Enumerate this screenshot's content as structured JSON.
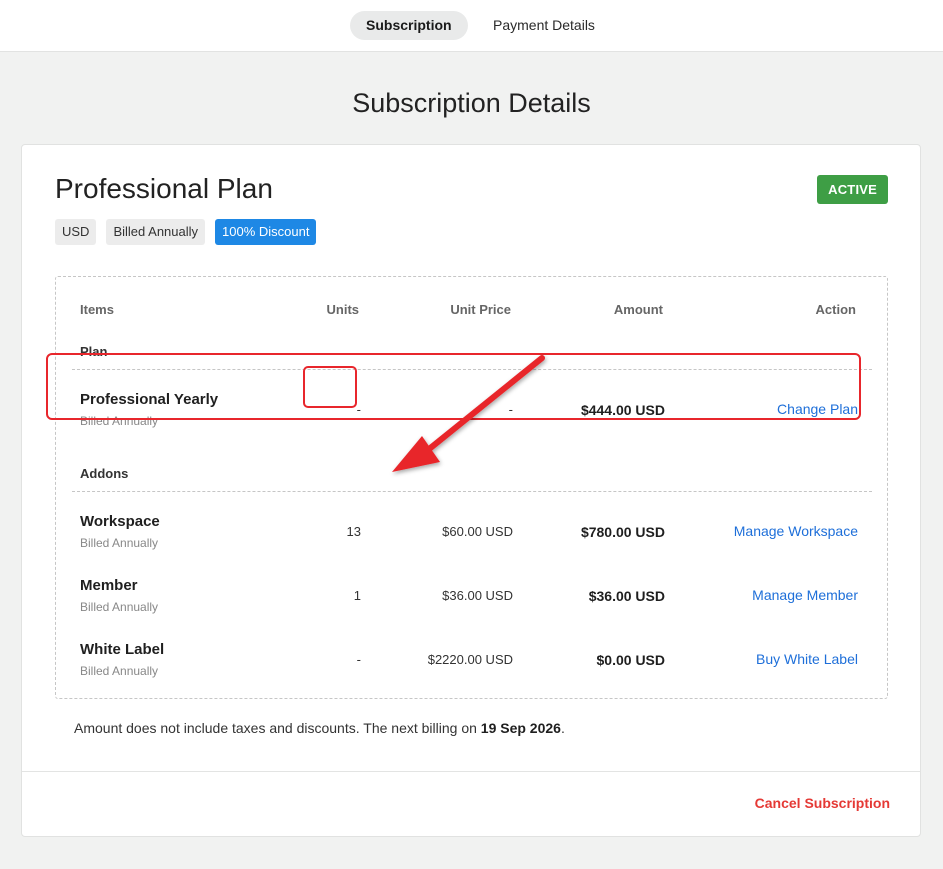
{
  "tabs": [
    {
      "label": "Subscription",
      "active": true
    },
    {
      "label": "Payment Details",
      "active": false
    }
  ],
  "page_title": "Subscription Details",
  "plan": {
    "name": "Professional Plan",
    "status": "ACTIVE",
    "tags": [
      "USD",
      "Billed Annually",
      "100% Discount"
    ]
  },
  "table": {
    "headers": {
      "items": "Items",
      "units": "Units",
      "unit_price": "Unit Price",
      "amount": "Amount",
      "action": "Action"
    },
    "plan_section": "Plan",
    "addons_section": "Addons",
    "rows": [
      {
        "name": "Professional Yearly",
        "billing": "Billed Annually",
        "units": "-",
        "unit_price": "-",
        "amount": "$444.00 USD",
        "action": "Change Plan"
      },
      {
        "name": "Workspace",
        "billing": "Billed Annually",
        "units": "13",
        "unit_price": "$60.00 USD",
        "amount": "$780.00 USD",
        "action": "Manage Workspace"
      },
      {
        "name": "Member",
        "billing": "Billed Annually",
        "units": "1",
        "unit_price": "$36.00 USD",
        "amount": "$36.00 USD",
        "action": "Manage Member"
      },
      {
        "name": "White Label",
        "billing": "Billed Annually",
        "units": "-",
        "unit_price": "$2220.00 USD",
        "amount": "$0.00 USD",
        "action": "Buy White Label"
      }
    ]
  },
  "footnote": {
    "text": "Amount does not include taxes and discounts. The next billing on ",
    "date": "19 Sep 2026",
    "end": "."
  },
  "cancel_label": "Cancel Subscription",
  "colors": {
    "active_badge": "#3e9e45",
    "discount_tag": "#1e88e5",
    "link": "#1e6fd9",
    "cancel": "#e53935",
    "annotation": "#e8262c"
  }
}
